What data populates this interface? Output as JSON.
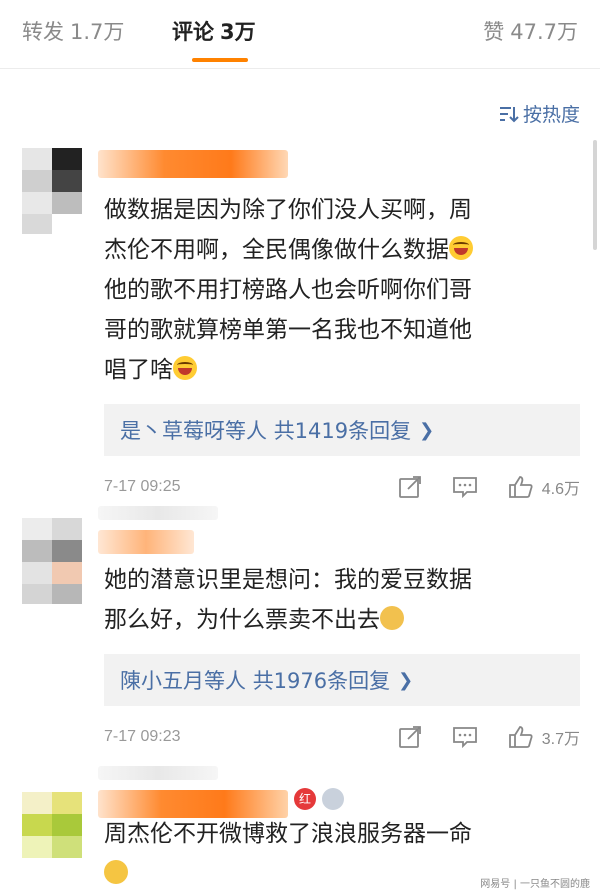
{
  "tabs": [
    {
      "label": "转发",
      "count": "1.7万"
    },
    {
      "label": "评论",
      "count": "3万"
    },
    {
      "label": "赞",
      "count": "47.7万"
    }
  ],
  "sort": {
    "label": "按热度",
    "icon": "sort-icon"
  },
  "comments": [
    {
      "text_lines": [
        "做数据是因为除了你们没人买啊，周",
        "杰伦不用啊，全民偶像做什么数据",
        "他的歌不用打榜路人也会听啊你们哥",
        "哥的歌就算榜单第一名我也不知道他",
        "唱了啥"
      ],
      "reply_prefix": "是丶草莓呀",
      "reply_mid": "等人",
      "reply_count": "共1419条回复",
      "time": "7-17 09:25",
      "like_count": "4.6万"
    },
    {
      "text_lines": [
        "她的潜意识里是想问：我的爱豆数据",
        "那么好，为什么票卖不出去"
      ],
      "reply_prefix": "陳小五月",
      "reply_mid": "等人",
      "reply_count": "共1976条回复",
      "time": "7-17 09:23",
      "like_count": "3.7万"
    },
    {
      "text_lines": [
        "周杰伦不开微博救了浪浪服务器一命"
      ],
      "badge": "红"
    }
  ],
  "watermark": "网易号 | 一只鱼不圆的鹿",
  "colors": {
    "accent": "#ff8200",
    "link": "#4a6fa5",
    "reply_bg": "#f2f2f2"
  }
}
